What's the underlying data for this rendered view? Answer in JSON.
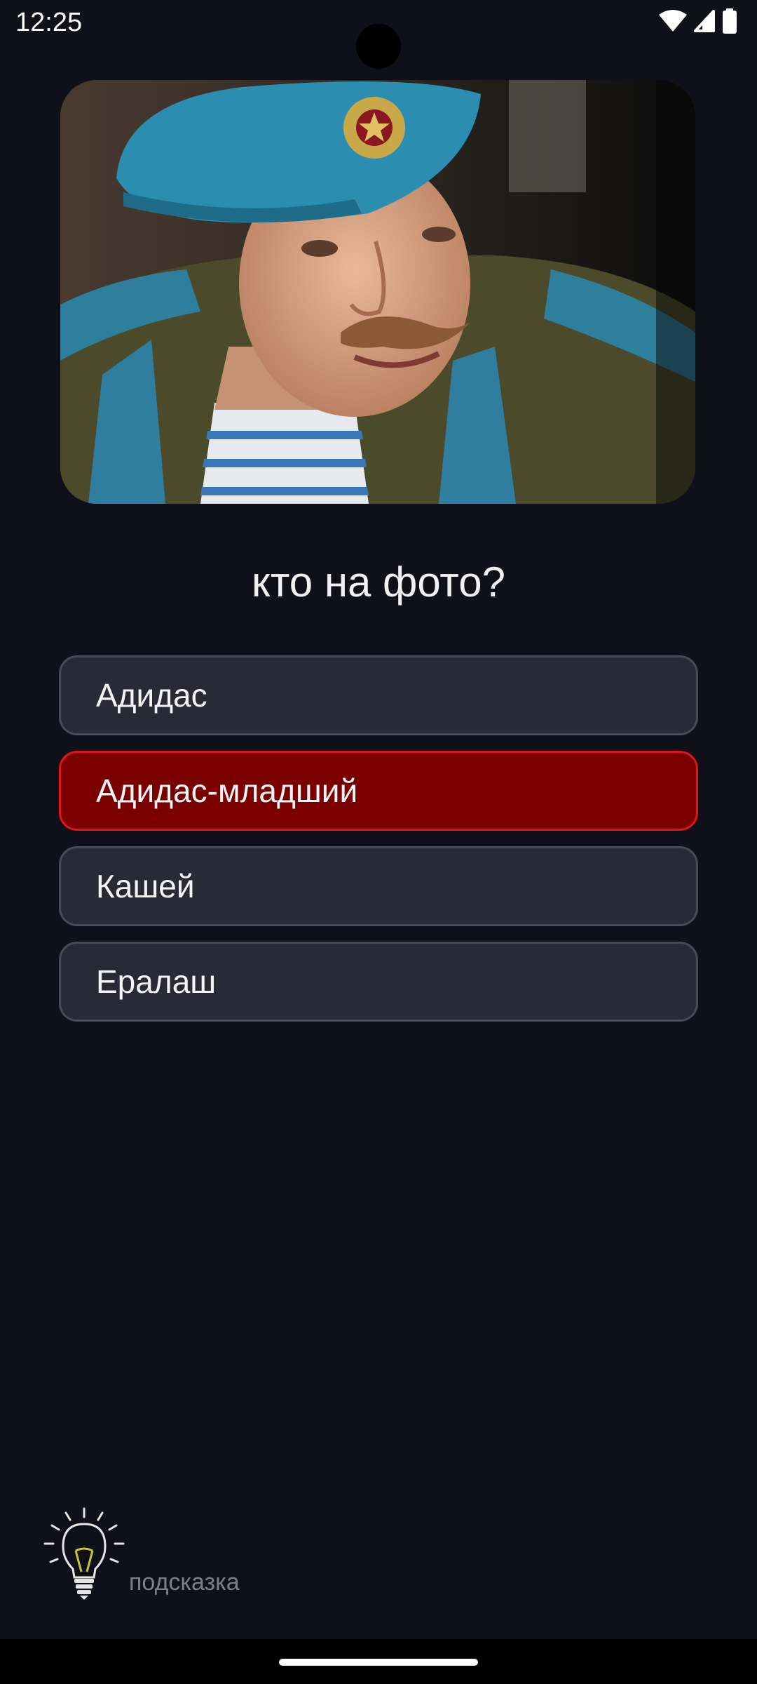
{
  "status_bar": {
    "time": "12:25",
    "icons": [
      "wifi-icon",
      "signal-icon",
      "battery-icon"
    ]
  },
  "photo": {
    "subject": "portrait-photo"
  },
  "question": {
    "text": "кто на фото?"
  },
  "answers": [
    {
      "label": "Адидас",
      "state": "default"
    },
    {
      "label": "Адидас-младший",
      "state": "wrong"
    },
    {
      "label": "Кашей",
      "state": "default"
    },
    {
      "label": "Ералаш",
      "state": "default"
    }
  ],
  "hint": {
    "label": "подсказка",
    "icon": "lightbulb-icon"
  },
  "colors": {
    "background": "#10101a",
    "answer_default": "#292a36",
    "answer_wrong": "#7a0000",
    "answer_wrong_border": "#e0141a",
    "hint_text": "#7d7e88"
  }
}
